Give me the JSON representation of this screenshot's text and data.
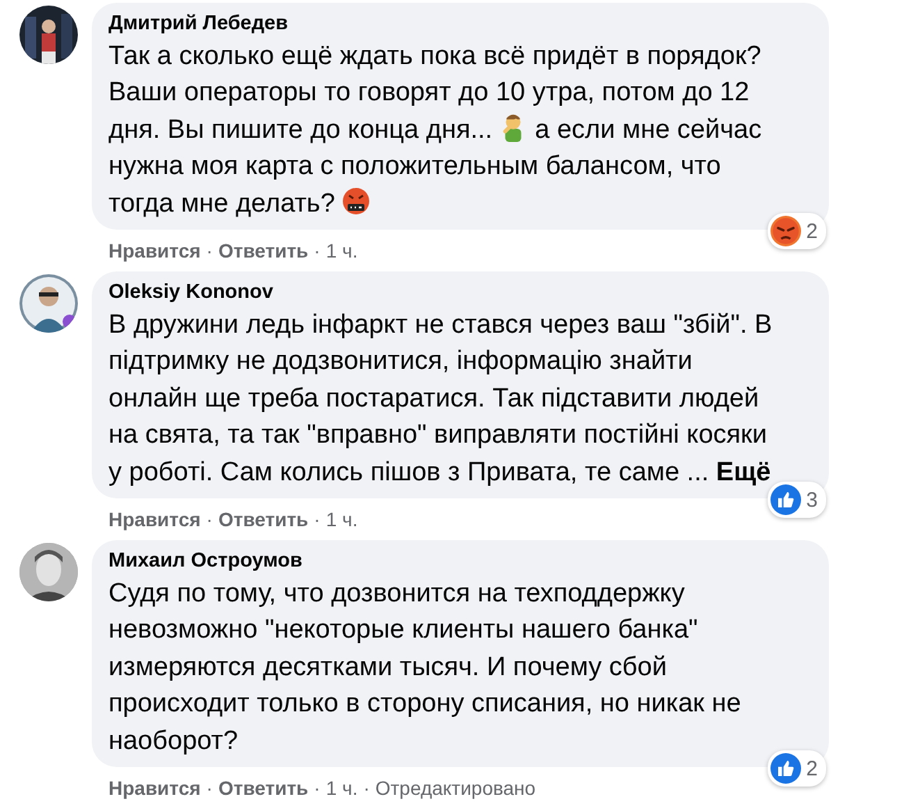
{
  "comments": [
    {
      "author": "Дмитрий Лебедев",
      "avatar": {
        "kind": "picture"
      },
      "lines": [
        [
          {
            "kind": "text",
            "text": "Так а сколько ещё ждать пока всё придёт в порядок?"
          }
        ],
        [
          {
            "kind": "text",
            "text": "Ваши операторы то говорят до 10 утра, потом до 12"
          }
        ],
        [
          {
            "kind": "text",
            "text": "дня. Вы пишите до конца дня..."
          },
          {
            "kind": "emoji-person"
          },
          {
            "kind": "text",
            "text": "а если мне сейчас"
          }
        ],
        [
          {
            "kind": "text",
            "text": "нужна моя карта с положительным балансом, что"
          }
        ],
        [
          {
            "kind": "text",
            "text": "тогда мне делать?"
          },
          {
            "kind": "emoji-cursing"
          }
        ]
      ],
      "reaction": {
        "kind": "angry",
        "count": "2"
      },
      "actions": {
        "like": "Нравится",
        "reply": "Ответить",
        "time": "1 ч.",
        "separator": "·"
      }
    },
    {
      "author": "Oleksiy Kononov",
      "avatar": {
        "kind": "picture"
      },
      "lines": [
        [
          {
            "kind": "text",
            "text": "В дружини ледь інфаркт не стався через ваш \"збій\". В"
          }
        ],
        [
          {
            "kind": "text",
            "text": "підтримку не додзвонитися, інформацію знайти"
          }
        ],
        [
          {
            "kind": "text",
            "text": "онлайн ще треба постаратися. Так підставити людей"
          }
        ],
        [
          {
            "kind": "text",
            "text": "на свята, та так \"вправно\" виправляти постійні косяки"
          }
        ],
        [
          {
            "kind": "text",
            "text": "у роботі. Сам колись пішов з Привата, те саме ..."
          },
          {
            "kind": "more",
            "text": "Ещё"
          }
        ]
      ],
      "reaction": {
        "kind": "like",
        "count": "3"
      },
      "actions": {
        "like": "Нравится",
        "reply": "Ответить",
        "time": "1 ч.",
        "separator": "·"
      }
    },
    {
      "author": "Михаил Остроумов",
      "avatar": {
        "kind": "picture"
      },
      "lines": [
        [
          {
            "kind": "text",
            "text": "Судя по тому, что дозвонится на техподдержку"
          }
        ],
        [
          {
            "kind": "text",
            "text": "невозможно \"некоторые клиенты нашего банка\""
          }
        ],
        [
          {
            "kind": "text",
            "text": "измеряются десятками тысяч. И почему сбой"
          }
        ],
        [
          {
            "kind": "text",
            "text": "происходит только в сторону списания, но никак не"
          }
        ],
        [
          {
            "kind": "text",
            "text": "наоборот?"
          }
        ]
      ],
      "reaction": {
        "kind": "like",
        "count": "2"
      },
      "actions": {
        "like": "Нравится",
        "reply": "Ответить",
        "time": "1 ч.",
        "separator": "·",
        "edited": "Отредактировано"
      }
    }
  ]
}
